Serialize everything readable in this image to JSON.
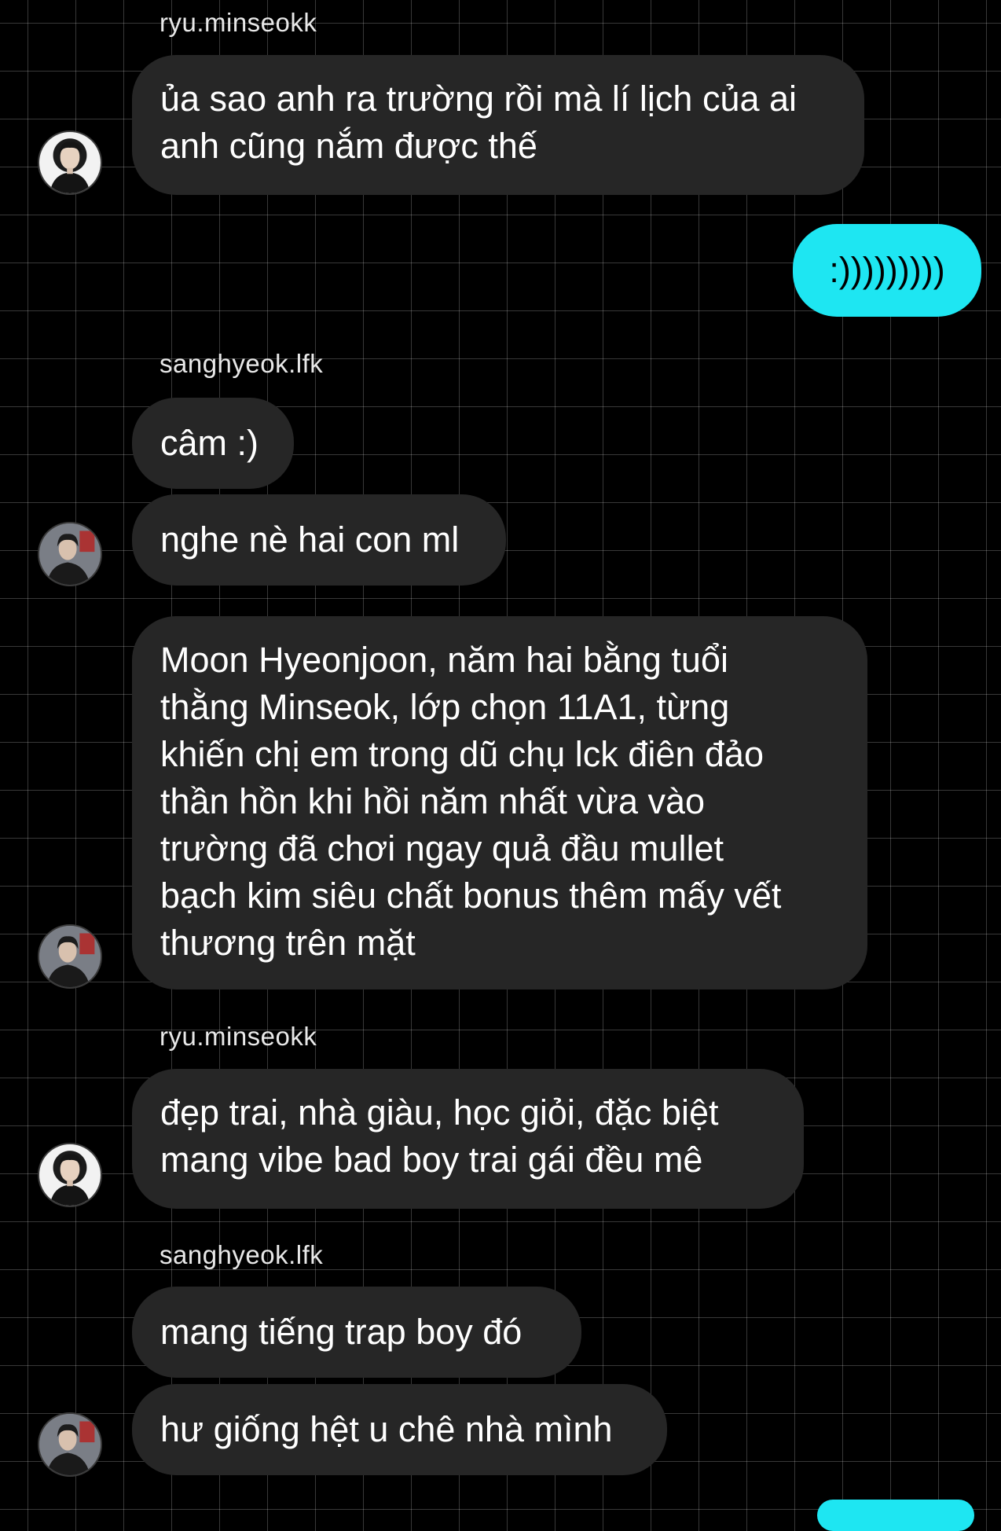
{
  "conversation": {
    "groups": [
      {
        "sender": "ryu.minseokk",
        "messages": [
          {
            "lines": [
              "ủa sao anh ra trường rồi mà lí lịch của ai",
              "anh cũng nắm được thế"
            ]
          }
        ]
      },
      {
        "outgoing": true,
        "messages": [
          {
            "text": ":)))))))))"
          }
        ]
      },
      {
        "sender": "sanghyeok.lfk",
        "messages": [
          {
            "text": "câm :)"
          },
          {
            "text": "nghe nè hai con ml"
          },
          {
            "lines": [
              "Moon Hyeonjoon, năm hai bằng tuổi",
              "thằng Minseok, lớp chọn 11A1, từng",
              "khiến chị em trong dũ chụ lck điên đảo",
              "thần hồn khi hồi năm nhất vừa vào",
              "trường đã chơi ngay quả đầu mullet",
              "bạch kim siêu chất bonus thêm mấy vết",
              "thương trên mặt"
            ]
          }
        ]
      },
      {
        "sender": "ryu.minseokk",
        "messages": [
          {
            "lines": [
              "đẹp trai, nhà giàu, học giỏi, đặc biệt",
              "mang vibe bad boy trai gái đều mê"
            ]
          }
        ]
      },
      {
        "sender": "sanghyeok.lfk",
        "messages": [
          {
            "text": "mang tiếng trap boy đó"
          },
          {
            "text": "hư giống hệt u chê nhà mình"
          }
        ]
      }
    ]
  },
  "colors": {
    "background": "#000000",
    "incoming_bubble": "#262626",
    "outgoing_bubble": "#1ee6f2",
    "grid": "#3a3a3a"
  }
}
